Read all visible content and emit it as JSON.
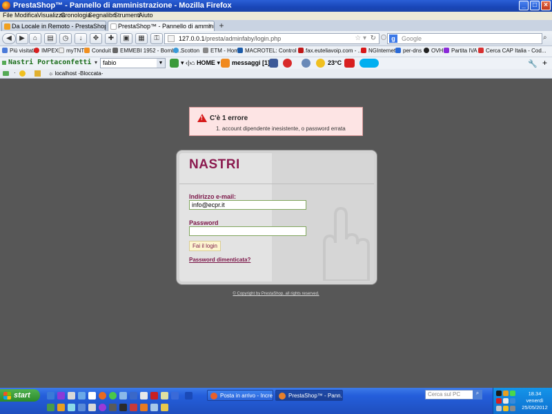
{
  "window": {
    "title": "PrestaShop™ - Pannello di amministrazione - Mozilla Firefox"
  },
  "menu": [
    "File",
    "Modifica",
    "Visualizza",
    "Cronologia",
    "Segnalibri",
    "Strumenti",
    "Aiuto"
  ],
  "tabs": [
    {
      "label": "Da Locale in Remoto - PrestaShop Forums"
    },
    {
      "label": "PrestaShop™ - Pannello di amministrazione"
    }
  ],
  "nav": {
    "url_prefix": "127.0.0.1",
    "url_path": "/presta/adminfaby/login.php",
    "search_placeholder": "Google"
  },
  "bookmarks": [
    "Più visitati",
    "IMPEX",
    "myTNT",
    "Conduit",
    "EMMEBI 1952 - Bombo...",
    "Scotton",
    "ETM - Home",
    "MACROTEL: Control P...",
    "fax.euteliavoip.com - ...",
    "NGInternet",
    "per-dns",
    "OVH",
    "Partita IVA",
    "Cerca CAP Italia - Cod..."
  ],
  "toolbar": {
    "brand": "Nastri Portaconfetti",
    "select_value": "fabio",
    "home_label": "HOME",
    "messages_label": "messaggi [1]",
    "temperature": "23°C"
  },
  "smallbar": {
    "label": "localhost -Bloccata-"
  },
  "error": {
    "title": "C'è 1 errore",
    "items": [
      "1.   account dipendente inesistente, o password errata"
    ]
  },
  "login": {
    "shop_name": "NASTRI",
    "email_label": "Indirizzo e-mail:",
    "email_value": "info@ecpr.it",
    "password_label": "Password",
    "password_value": "",
    "submit_label": "Fai il login",
    "forgot_label": "Password dimenticata?"
  },
  "footer": {
    "copyright": "© Copyright by PrestaShop. all rights reserved."
  },
  "taskbar": {
    "start_label": "start",
    "tasks": [
      "Posta in arrivo - Incre...",
      "PrestaShop™ - Pann..."
    ],
    "search_placeholder": "Cerca sul PC",
    "time": "18.34",
    "day": "venerdì",
    "date": "25/05/2012"
  },
  "colors": {
    "accent": "#7a1446",
    "page_bg": "#575757",
    "error_bg": "#fde4e4"
  }
}
